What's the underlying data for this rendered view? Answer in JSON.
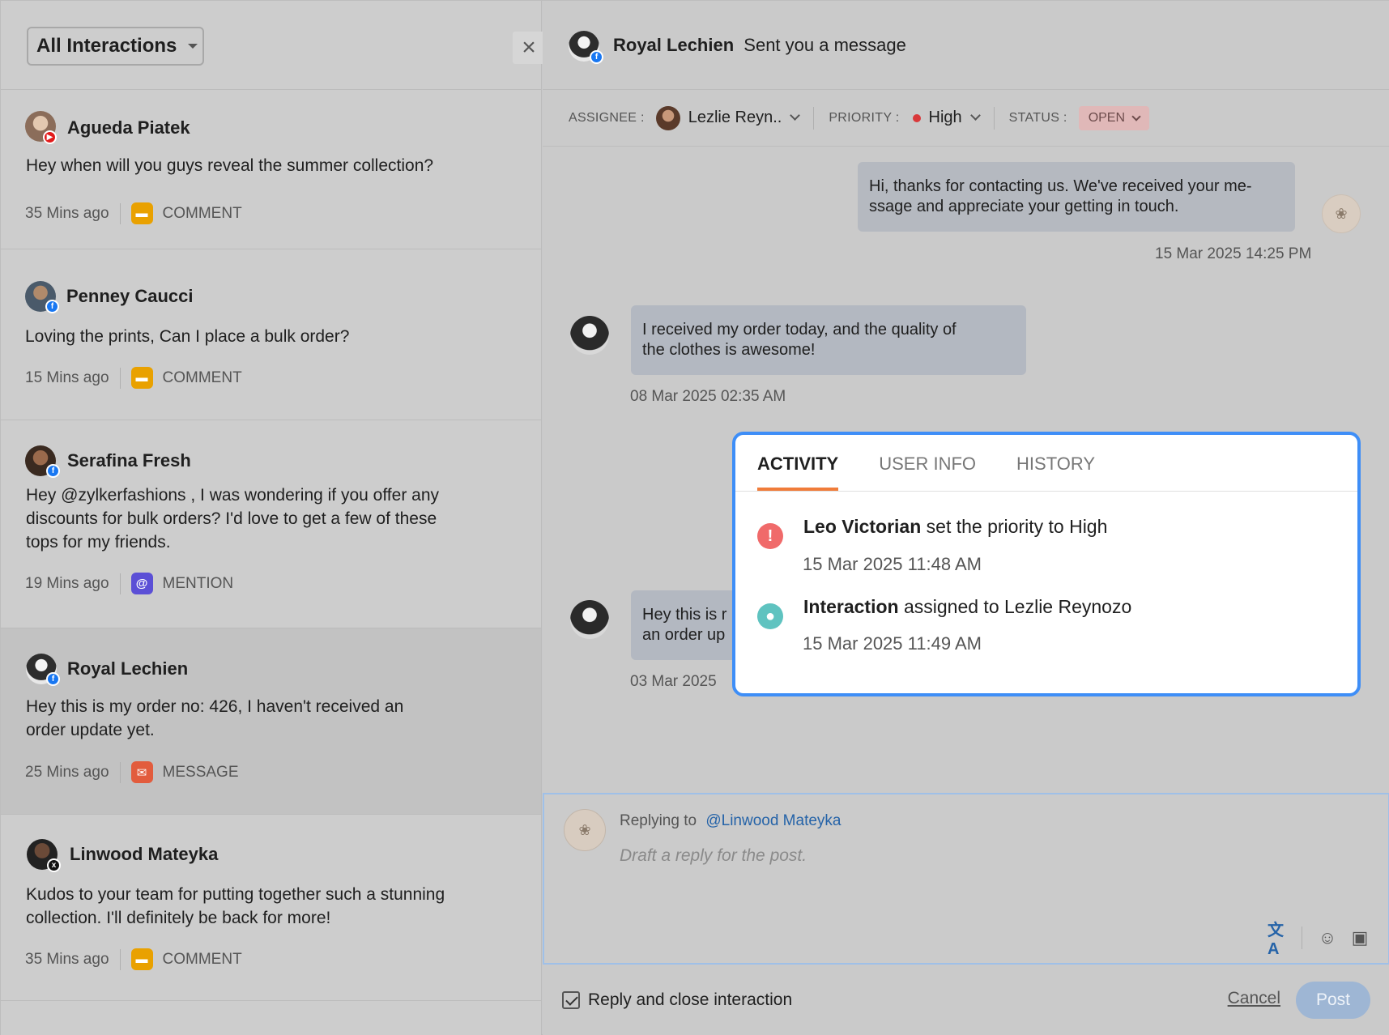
{
  "filter": {
    "label": "All Interactions"
  },
  "interactions": [
    {
      "name": "Agueda Piatek",
      "source": "youtube",
      "message": "Hey when will you guys reveal the summer collection?",
      "time": "35 Mins ago",
      "type": "COMMENT"
    },
    {
      "name": "Penney Caucci",
      "source": "facebook",
      "message": "Loving the prints, Can I place a bulk order?",
      "time": "15 Mins ago",
      "type": "COMMENT"
    },
    {
      "name": "Serafina Fresh",
      "source": "facebook",
      "message": "Hey @zylkerfashions , I was wondering if you offer any discounts for bulk orders? I'd love to get a few of these tops for my friends.",
      "time": "19 Mins ago",
      "type": "MENTION"
    },
    {
      "name": "Royal Lechien",
      "source": "facebook",
      "message": "Hey this is my order no: 426, I haven't received an order update yet.",
      "time": "25 Mins ago",
      "type": "MESSAGE"
    },
    {
      "name": "Linwood Mateyka",
      "source": "x",
      "message": "Kudos to your team for putting together such a stunning collection. I'll definitely be back for more!",
      "time": "35 Mins ago",
      "type": "COMMENT"
    }
  ],
  "header": {
    "name": "Royal Lechien",
    "subtitle": "Sent you a message"
  },
  "props": {
    "assignee_label": "ASSIGNEE :",
    "assignee": "Lezlie Reyn..",
    "priority_label": "PRIORITY :",
    "priority": "High",
    "status_label": "STATUS :",
    "status": "OPEN"
  },
  "chat": {
    "out1_text": "Hi, thanks for contacting us. We've received your me-ssage and appreciate your getting in touch.",
    "out1_line1": "Hi, thanks for contacting us. We've received your me-",
    "out1_line2": "ssage and appreciate your getting in touch.",
    "out1_time": "15 Mar 2025 14:25 PM",
    "in1_line1": "I received my order today, and the quality of",
    "in1_line2": "the clothes is awesome!",
    "in1_time": "08 Mar 2025 02:35 AM",
    "in2_line1": "Hey this is r",
    "in2_line2": "an order up",
    "in2_time": "03 Mar 2025"
  },
  "popup": {
    "tabs": [
      "ACTIVITY",
      "USER INFO",
      "HISTORY"
    ],
    "activities": [
      {
        "actor": "Leo Victorian",
        "text": "set the priority to High",
        "time": "15 Mar 2025 11:48 AM"
      },
      {
        "actor": "Interaction",
        "text": "assigned to Lezlie Reynozo",
        "time": "15 Mar 2025 11:49 AM"
      }
    ]
  },
  "reply": {
    "replying_label": "Replying to",
    "handle": "@Linwood Mateyka",
    "placeholder": "Draft a reply for the post."
  },
  "footer": {
    "checkbox_label": "Reply and close interaction",
    "cancel": "Cancel",
    "post": "Post"
  },
  "icons": {
    "source_badges": [
      "youtube-icon",
      "facebook-icon",
      "x-icon"
    ],
    "types": {
      "COMMENT": "comment-icon",
      "MENTION": "at-icon",
      "MESSAGE": "mail-icon"
    }
  },
  "colors": {
    "accent": "#3e8ef7",
    "tab_active": "#f07c3a",
    "priority_high": "#d9383a"
  }
}
